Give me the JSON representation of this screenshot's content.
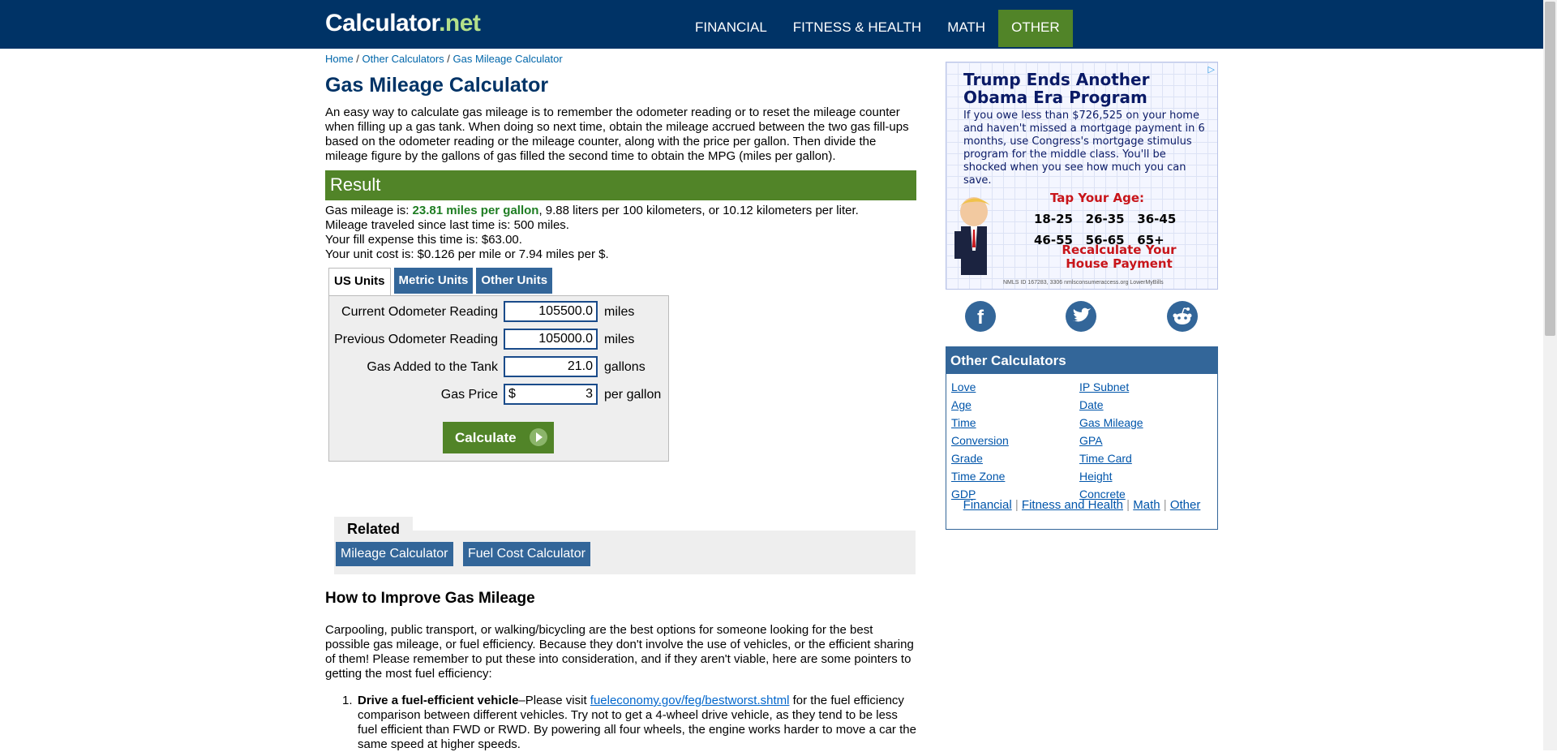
{
  "header": {
    "logo_main": "Calculator",
    "logo_suffix": ".net",
    "nav": [
      "FINANCIAL",
      "FITNESS & HEALTH",
      "MATH",
      "OTHER"
    ]
  },
  "breadcrumb": [
    "Home",
    "Other Calculators",
    "Gas Mileage Calculator"
  ],
  "title": "Gas Mileage Calculator",
  "intro": "An easy way to calculate gas mileage is to remember the odometer reading or to reset the mileage counter when filling up a gas tank. When doing so next time, obtain the mileage accrued between the two gas fill-ups based on the odometer reading or the mileage counter, along with the price per gallon. Then divide the mileage figure by the gallons of gas filled the second time to obtain the MPG (miles per gallon).",
  "result": {
    "heading": "Result",
    "line1_prefix": "Gas mileage is: ",
    "line1_highlight": "23.81 miles per gallon",
    "line1_suffix": ", 9.88 liters per 100 kilometers, or 10.12 kilometers per liter.",
    "line2": "Mileage traveled since last time is: 500 miles.",
    "line3": "Your fill expense this time is: $63.00.",
    "line4": "Your unit cost is: $0.126 per mile or 7.94 miles per $."
  },
  "tabs": [
    "US Units",
    "Metric Units",
    "Other Units"
  ],
  "form": {
    "current_odometer": {
      "label": "Current Odometer Reading",
      "value": "105500.0",
      "unit": "miles"
    },
    "previous_odometer": {
      "label": "Previous Odometer Reading",
      "value": "105000.0",
      "unit": "miles"
    },
    "gas_added": {
      "label": "Gas Added to the Tank",
      "value": "21.0",
      "unit": "gallons"
    },
    "gas_price": {
      "label": "Gas Price",
      "prefix": "$",
      "value": "3",
      "unit": "per gallon"
    },
    "calculate_label": "Calculate"
  },
  "related": {
    "heading": "Related",
    "links": [
      "Mileage Calculator",
      "Fuel Cost Calculator"
    ]
  },
  "article": {
    "heading": "How to Improve Gas Mileage",
    "para1": "Carpooling, public transport, or walking/bicycling are the best options for someone looking for the best possible gas mileage, or fuel efficiency. Because they don't involve the use of vehicles, or the efficient sharing of them! Please remember to put these into consideration, and if they aren't viable, here are some pointers to getting the most fuel efficiency:",
    "item1_num": "1.",
    "item1_bold": "Drive a fuel-efficient vehicle",
    "item1_dash": "–Please visit ",
    "item1_link": "fueleconomy.gov/feg/bestworst.shtml",
    "item1_rest": " for the fuel efficiency comparison between different vehicles. Try not to get a 4-wheel drive vehicle, as they tend to be less fuel efficient than FWD or RWD. By powering all four wheels, the engine works harder to move a car the same speed at higher speeds."
  },
  "ad": {
    "headline": "Trump Ends Another Obama Era Program",
    "body": "If you owe less than $726,525 on your home and haven't missed a mortgage payment in 6 months, use Congress's mortgage stimulus program for the middle class. You'll be shocked when you see how much you can save.",
    "tap": "Tap Your Age:",
    "ages_row1": "18-25   26-35   36-45",
    "ages_row2": "46-55   56-65   65+",
    "recalc": "Recalculate Your House Payment",
    "fine": "NMLS ID 167283, 3306   nmlsconsumeraccess.org   LowerMyBills",
    "choice_icon": "adchoices-icon"
  },
  "social": [
    "facebook-icon",
    "twitter-icon",
    "reddit-icon"
  ],
  "other_calculators": {
    "heading": "Other Calculators",
    "left": [
      "Love",
      "Age",
      "Time",
      "Conversion",
      "Grade",
      "Time Zone",
      "GDP"
    ],
    "right": [
      "IP Subnet",
      "Date",
      "Gas Mileage",
      "GPA",
      "Time Card",
      "Height",
      "Concrete"
    ],
    "footer": [
      "Financial",
      "Fitness and Health",
      "Math",
      "Other"
    ]
  },
  "colors": {
    "brand_navy": "#003366",
    "brand_green": "#518428",
    "tab_blue": "#336699",
    "result_highlight": "#1e7d22"
  }
}
